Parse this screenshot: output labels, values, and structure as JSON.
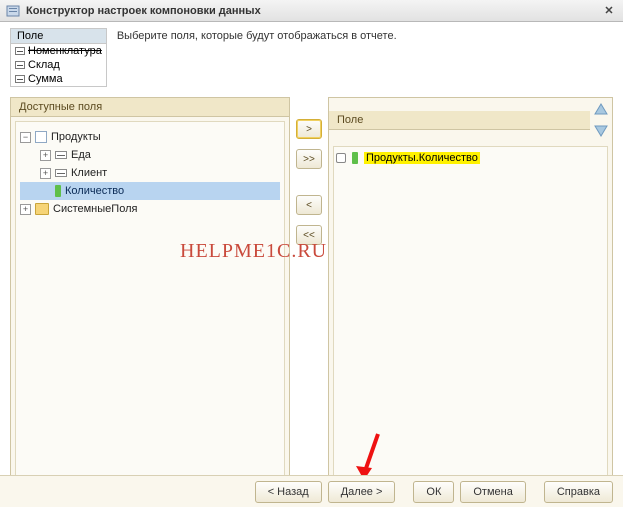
{
  "window": {
    "title": "Конструктор настроек компоновки данных"
  },
  "legend": {
    "header": "Поле",
    "rows": [
      {
        "label": "Номенклатура",
        "struck": true
      },
      {
        "label": "Склад",
        "struck": false
      },
      {
        "label": "Сумма",
        "struck": false
      }
    ]
  },
  "instruction": "Выберите поля, которые будут отображаться в отчете.",
  "panels": {
    "available_header": "Доступные поля",
    "selected_header": "Поле"
  },
  "tree": {
    "root": {
      "label": "Продукты"
    },
    "children": [
      {
        "label": "Еда",
        "icon": "dash"
      },
      {
        "label": "Клиент",
        "icon": "dash"
      },
      {
        "label": "Количество",
        "icon": "green",
        "selected": true
      }
    ],
    "system": {
      "label": "СистемныеПоля"
    }
  },
  "move_buttons": {
    "add": ">",
    "add_all": ">>",
    "remove": "<",
    "remove_all": "<<"
  },
  "selected_list": {
    "items": [
      {
        "label": "Продукты.Количество",
        "highlighted": true
      }
    ]
  },
  "watermark": "HELPME1C.RU",
  "footer": {
    "back": "< Назад",
    "next": "Далее >",
    "ok": "ОК",
    "cancel": "Отмена",
    "help": "Справка"
  }
}
